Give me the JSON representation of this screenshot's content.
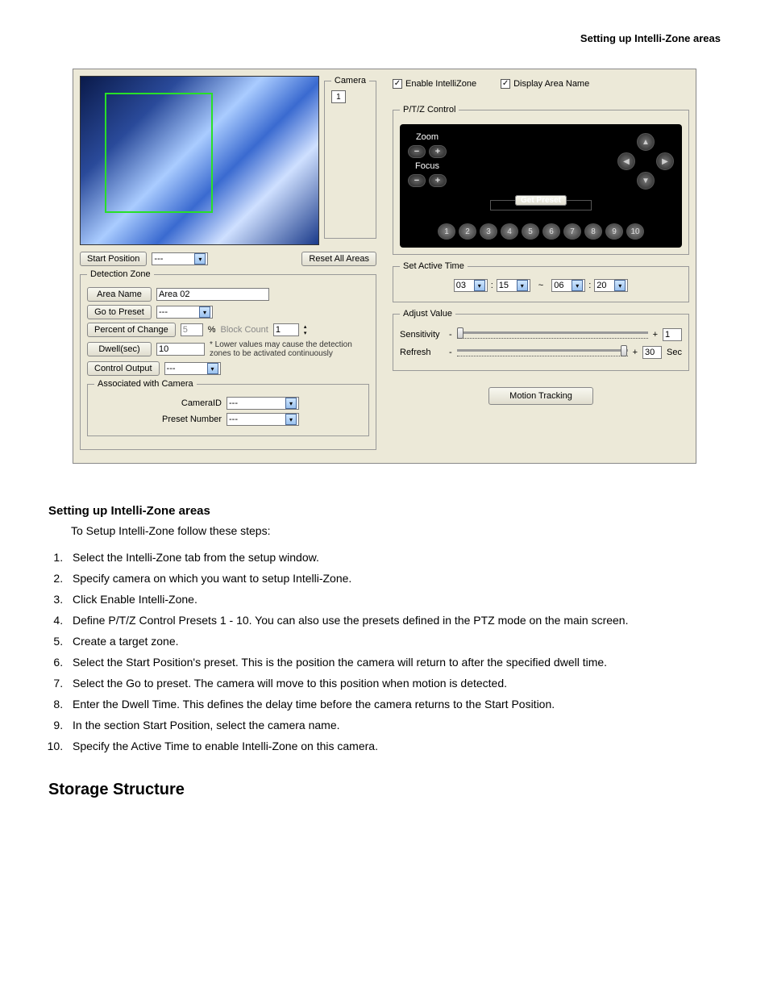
{
  "header": {
    "title": "Setting up Intelli-Zone areas"
  },
  "screenshot": {
    "camera_legend": "Camera",
    "camera_value": "1",
    "start_position_label": "Start Position",
    "start_position_value": "---",
    "reset_btn": "Reset All Areas",
    "detection_zone": {
      "legend": "Detection Zone",
      "area_name_btn": "Area Name",
      "area_name_value": "Area 02",
      "goto_preset_btn": "Go to Preset",
      "goto_preset_value": "---",
      "percent_btn": "Percent of Change",
      "percent_value": "5",
      "percent_unit": "%",
      "block_count_label": "Block Count",
      "block_count_value": "1",
      "note": "* Lower values may cause the detection zones to be activated continuously",
      "dwell_btn": "Dwell(sec)",
      "dwell_value": "10",
      "control_output_btn": "Control Output",
      "control_output_value": "---",
      "assoc_legend": "Associated with Camera",
      "camera_id_label": "CameraID",
      "camera_id_value": "---",
      "preset_number_label": "Preset Number",
      "preset_number_value": "---"
    },
    "right": {
      "enable_label": "Enable IntelliZone",
      "display_label": "Display Area Name",
      "ptz_legend": "P/T/Z Control",
      "zoom_label": "Zoom",
      "focus_label": "Focus",
      "get_preset_btn": "Get Preset",
      "presets": [
        "1",
        "2",
        "3",
        "4",
        "5",
        "6",
        "7",
        "8",
        "9",
        "10"
      ],
      "active_legend": "Set Active Time",
      "time_h1": "03",
      "time_m1": "15",
      "time_sep": "~",
      "time_h2": "06",
      "time_m2": "20",
      "adjust_legend": "Adjust Value",
      "sensitivity_label": "Sensitivity",
      "sensitivity_value": "1",
      "refresh_label": "Refresh",
      "refresh_value": "30",
      "refresh_unit": "Sec",
      "motion_btn": "Motion Tracking"
    }
  },
  "doc": {
    "section_title": "Setting up Intelli-Zone areas",
    "intro": "To Setup Intelli-Zone follow these steps:",
    "steps": [
      "Select the Intelli-Zone tab from the setup window.",
      "Specify camera on which you want to setup Intelli-Zone.",
      "Click Enable Intelli-Zone.",
      "Define P/T/Z Control Presets 1 - 10. You can also use the presets defined in the PTZ mode on the main screen.",
      "Create a target zone.",
      "Select the Start Position's preset. This is the position the camera will return to after the specified dwell time.",
      "Select the Go to preset. The camera will move to this position when motion is detected.",
      "Enter the Dwell Time. This defines the delay time before the camera returns to the Start Position.",
      "In the section Start Position, select the camera name.",
      "Specify the Active Time to enable Intelli-Zone on this camera."
    ],
    "main_heading": "Storage Structure"
  }
}
